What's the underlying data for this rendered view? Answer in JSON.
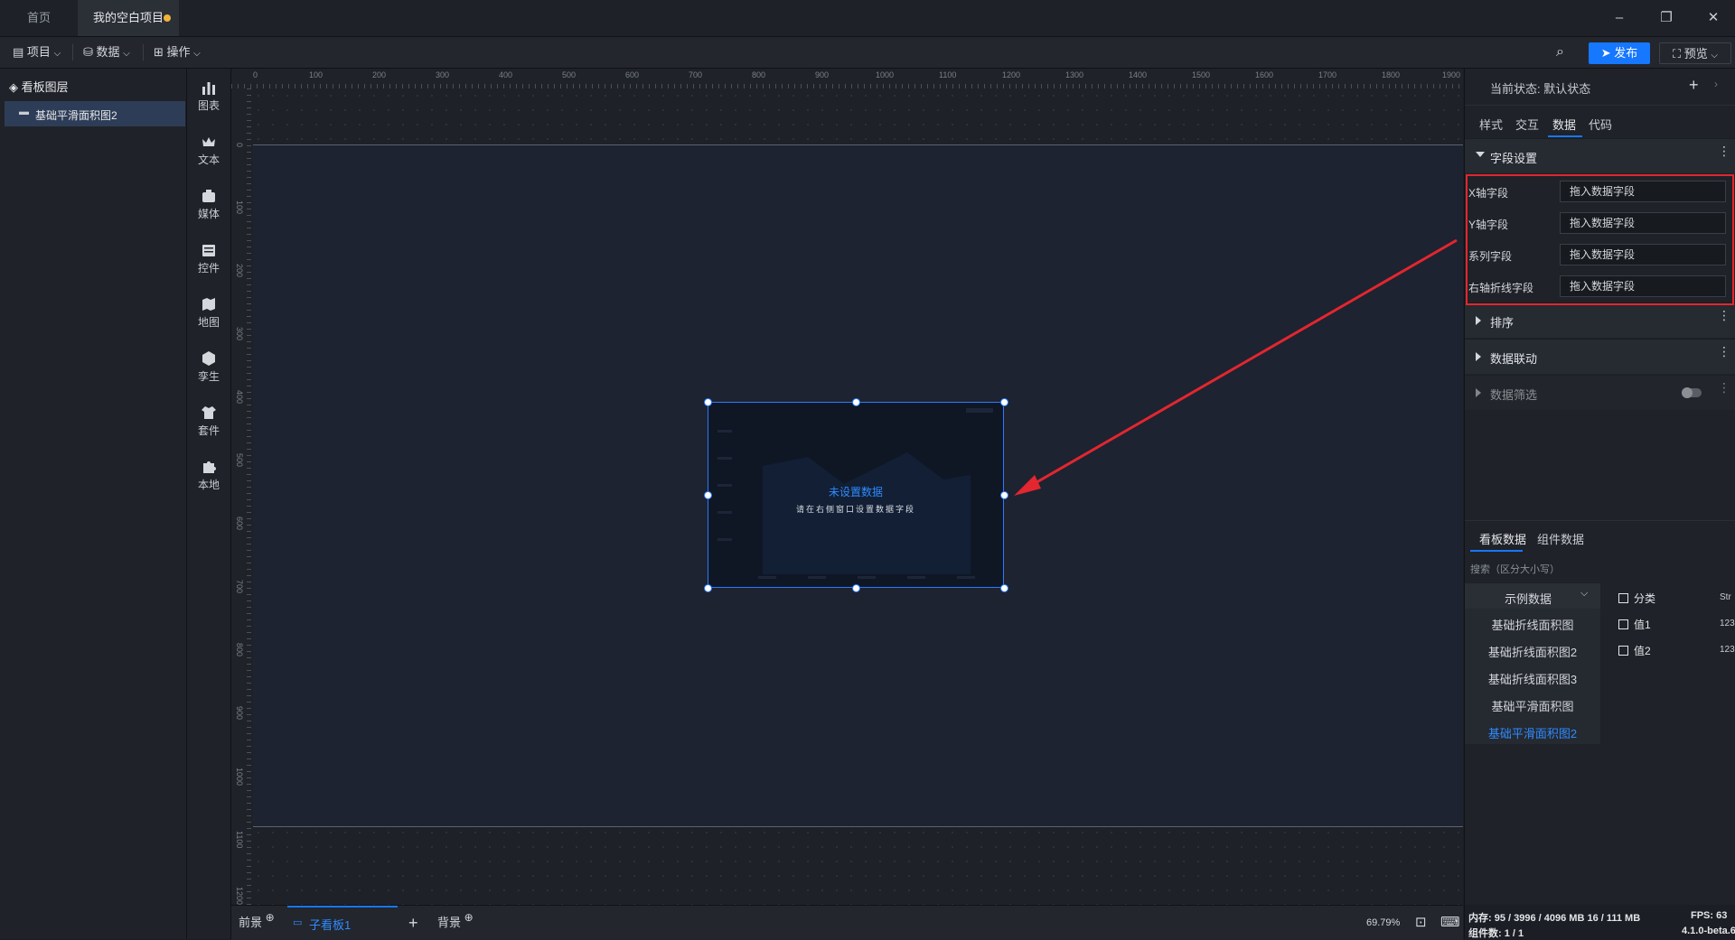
{
  "tabs": {
    "home": "首页",
    "project": "我的空白项目"
  },
  "window": {
    "minimize": "–",
    "restore": "❐",
    "close": "✕"
  },
  "toolbar": {
    "project": "项目",
    "data": "数据",
    "operate": "操作",
    "publish": "发布",
    "preview": "预览"
  },
  "layers": {
    "title": "看板图层",
    "item": "基础平滑面积图2"
  },
  "rail": [
    "图表",
    "文本",
    "媒体",
    "控件",
    "地图",
    "孪生",
    "套件",
    "本地"
  ],
  "ruler": {
    "top": [
      "0",
      "100",
      "200",
      "300",
      "400",
      "500",
      "600",
      "700",
      "800",
      "900",
      "1000",
      "1100",
      "1200",
      "1300",
      "1400",
      "1500",
      "1600",
      "1700",
      "1800",
      "1900"
    ],
    "left": [
      "0",
      "100",
      "200",
      "300",
      "400",
      "500",
      "600",
      "700",
      "800",
      "900",
      "1000",
      "1100",
      "1200"
    ]
  },
  "widget": {
    "title": "未设置数据",
    "subtitle": "请在右侧窗口设置数据字段"
  },
  "bottombar": {
    "front": "前景",
    "sub": "子看板1",
    "add": "+",
    "back": "背景",
    "zoom": "69.79%"
  },
  "rpanel": {
    "state": "当前状态:  默认状态",
    "tabs": [
      "样式",
      "交互",
      "数据",
      "代码"
    ],
    "field_section": "字段设置",
    "fields": [
      {
        "label": "X轴字段",
        "placeholder": "拖入数据字段"
      },
      {
        "label": "Y轴字段",
        "placeholder": "拖入数据字段"
      },
      {
        "label": "系列字段",
        "placeholder": "拖入数据字段"
      },
      {
        "label": "右轴折线字段",
        "placeholder": "拖入数据字段"
      }
    ],
    "sections": [
      "排序",
      "数据联动",
      "数据筛选"
    ],
    "ds_tabs": [
      "看板数据",
      "组件数据"
    ],
    "search": "搜索（区分大小写）",
    "ds_group": "示例数据",
    "ds_items": [
      "基础折线面积图",
      "基础折线面积图2",
      "基础折线面积图3",
      "基础平滑面积图",
      "基础平滑面积图2"
    ],
    "data_fields": [
      {
        "name": "分类",
        "type": "Str"
      },
      {
        "name": "值1",
        "type": "123"
      },
      {
        "name": "值2",
        "type": "123"
      }
    ],
    "status": {
      "memory": "内存:  95 / 3996 / 4096 MB 16 / 111 MB",
      "fps": "FPS:  63",
      "count": "组件数: 1 / 1",
      "version": "4.1.0-beta.6"
    }
  },
  "colors": {
    "accent": "#1677ff",
    "highlight": "#e3262f",
    "tab_dot": "#f2b13a"
  }
}
